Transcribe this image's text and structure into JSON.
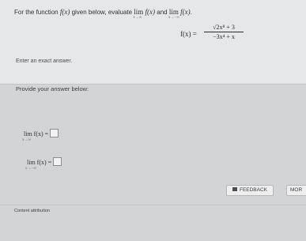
{
  "question": {
    "prompt_prefix": "For the function",
    "prompt_fx": "f(x)",
    "prompt_middle": "given below, evaluate",
    "lim_word": "lim",
    "lim_pos_sub": "x→∞",
    "prompt_and": "and",
    "lim_neg_sub": "x→−∞",
    "function_label": "f(x) =",
    "numerator": "√2x⁸ + 3",
    "denominator": "−3x⁴ + x",
    "exact_answer": "Enter an exact answer."
  },
  "answer": {
    "provide_label": "Provide your answer below:",
    "lim1_word": "lim",
    "lim1_sub": "x→∞",
    "lim1_eq": "f(x) =",
    "lim2_word": "lim",
    "lim2_sub": "x→−∞",
    "lim2_eq": "f(x) ="
  },
  "footer": {
    "feedback_label": "FEEDBACK",
    "more_label": "MOR",
    "attribution": "Content attribution"
  }
}
